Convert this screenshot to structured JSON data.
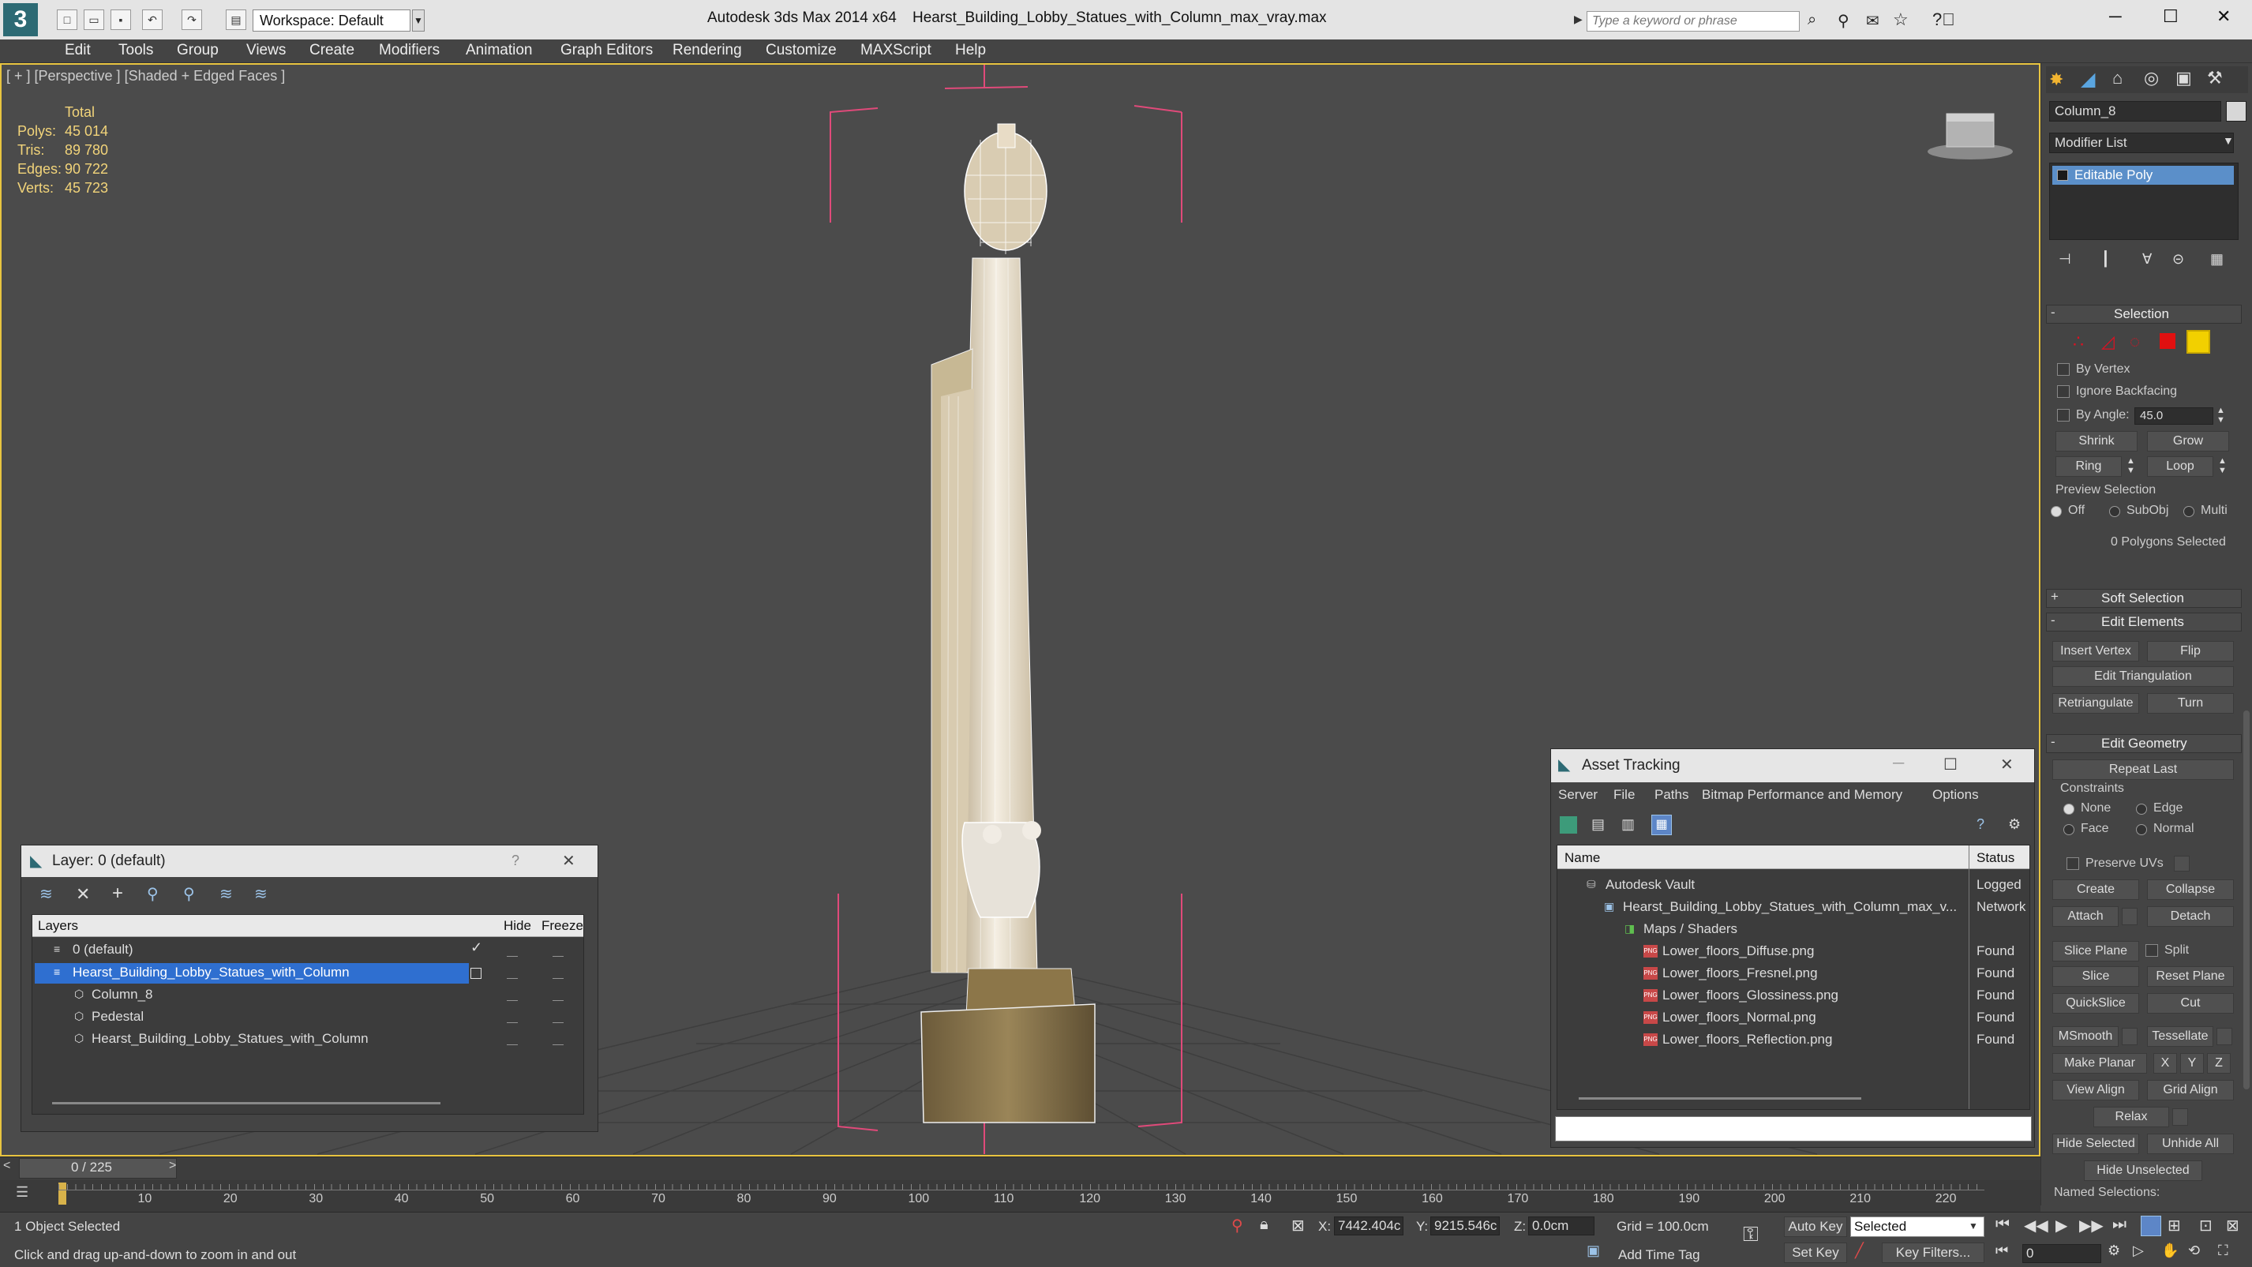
{
  "titlebar": {
    "workspace": "Workspace: Default",
    "app_title": "Autodesk 3ds Max  2014 x64",
    "file_title": "Hearst_Building_Lobby_Statues_with_Column_max_vray.max",
    "search_placeholder": "Type a keyword or phrase",
    "logo": "3",
    "minimize": "─",
    "maximize": "☐",
    "close": "✕"
  },
  "menu": [
    "Edit",
    "Tools",
    "Group",
    "Views",
    "Create",
    "Modifiers",
    "Animation",
    "Graph Editors",
    "Rendering",
    "Customize",
    "MAXScript",
    "Help"
  ],
  "viewport": {
    "label": "[ + ] [Perspective ] [Shaded + Edged Faces ]",
    "stats": {
      "header": "Total",
      "rows": [
        {
          "label": "Polys:",
          "value": "45 014"
        },
        {
          "label": "Tris:",
          "value": "89 780"
        },
        {
          "label": "Edges:",
          "value": "90 722"
        },
        {
          "label": "Verts:",
          "value": "45 723"
        }
      ]
    }
  },
  "command_panel": {
    "object_name": "Column_8",
    "modifier_list": "Modifier List",
    "stack_item": "Editable Poly",
    "selection": {
      "header": "Selection",
      "by_vertex": "By Vertex",
      "ignore_backfacing": "Ignore Backfacing",
      "by_angle": "By Angle:",
      "angle_value": "45.0",
      "shrink": "Shrink",
      "grow": "Grow",
      "ring": "Ring",
      "loop": "Loop",
      "preview_label": "Preview Selection",
      "preview_off": "Off",
      "preview_subobj": "SubObj",
      "preview_multi": "Multi",
      "status": "0 Polygons Selected"
    },
    "soft_selection": "Soft Selection",
    "edit_elements": {
      "header": "Edit Elements",
      "insert_vertex": "Insert Vertex",
      "flip": "Flip",
      "edit_triangulation": "Edit Triangulation",
      "retriangulate": "Retriangulate",
      "turn": "Turn"
    },
    "edit_geometry": {
      "header": "Edit Geometry",
      "repeat_last": "Repeat Last",
      "constraints": "Constraints",
      "none": "None",
      "edge": "Edge",
      "face": "Face",
      "normal": "Normal",
      "preserve_uvs": "Preserve UVs",
      "create": "Create",
      "collapse": "Collapse",
      "attach": "Attach",
      "detach": "Detach",
      "slice_plane": "Slice Plane",
      "split": "Split",
      "slice": "Slice",
      "reset_plane": "Reset Plane",
      "quickslice": "QuickSlice",
      "cut": "Cut",
      "msmooth": "MSmooth",
      "tessellate": "Tessellate",
      "make_planar": "Make Planar",
      "x": "X",
      "y": "Y",
      "z": "Z",
      "view_align": "View Align",
      "grid_align": "Grid Align",
      "relax": "Relax",
      "hide_selected": "Hide Selected",
      "unhide_all": "Unhide All",
      "hide_unselected": "Hide Unselected",
      "named_selections": "Named Selections:"
    }
  },
  "layer_dialog": {
    "title": "Layer: 0 (default)",
    "help": "?",
    "close": "✕",
    "columns": {
      "layers": "Layers",
      "hide": "Hide",
      "freeze": "Freeze"
    },
    "rows": [
      {
        "name": "0 (default)",
        "indent": 0,
        "selected": false
      },
      {
        "name": "Hearst_Building_Lobby_Statues_with_Column",
        "indent": 0,
        "selected": true
      },
      {
        "name": "Column_8",
        "indent": 1,
        "selected": false
      },
      {
        "name": "Pedestal",
        "indent": 1,
        "selected": false
      },
      {
        "name": "Hearst_Building_Lobby_Statues_with_Column",
        "indent": 1,
        "selected": false
      }
    ]
  },
  "asset_dialog": {
    "title": "Asset Tracking",
    "menu": [
      "Server",
      "File",
      "Paths",
      "Bitmap Performance and Memory",
      "Options"
    ],
    "columns": {
      "name": "Name",
      "status": "Status"
    },
    "rows": [
      {
        "name": "Autodesk Vault",
        "status": "Logged",
        "indent": 1
      },
      {
        "name": "Hearst_Building_Lobby_Statues_with_Column_max_v...",
        "status": "Network",
        "indent": 2
      },
      {
        "name": "Maps / Shaders",
        "status": "",
        "indent": 3
      },
      {
        "name": "Lower_floors_Diffuse.png",
        "status": "Found",
        "indent": 4
      },
      {
        "name": "Lower_floors_Fresnel.png",
        "status": "Found",
        "indent": 4
      },
      {
        "name": "Lower_floors_Glossiness.png",
        "status": "Found",
        "indent": 4
      },
      {
        "name": "Lower_floors_Normal.png",
        "status": "Found",
        "indent": 4
      },
      {
        "name": "Lower_floors_Reflection.png",
        "status": "Found",
        "indent": 4
      }
    ]
  },
  "timeline": {
    "frame_display": "0 / 225",
    "ticks": [
      "10",
      "20",
      "30",
      "40",
      "50",
      "60",
      "70",
      "80",
      "90",
      "100",
      "110",
      "120",
      "130",
      "140",
      "150",
      "160",
      "170",
      "180",
      "190",
      "200",
      "210",
      "220"
    ]
  },
  "statusbar": {
    "selected": "1 Object Selected",
    "prompt": "Click and drag up-and-down to zoom in and out",
    "x_label": "X:",
    "x_value": "7442.404c",
    "y_label": "Y:",
    "y_value": "9215.546c",
    "z_label": "Z:",
    "z_value": "0.0cm",
    "grid": "Grid = 100.0cm",
    "auto_key": "Auto Key",
    "selected_mode": "Selected",
    "set_key": "Set Key",
    "key_filters": "Key Filters...",
    "add_time_tag": "Add Time Tag",
    "frame": "0"
  }
}
